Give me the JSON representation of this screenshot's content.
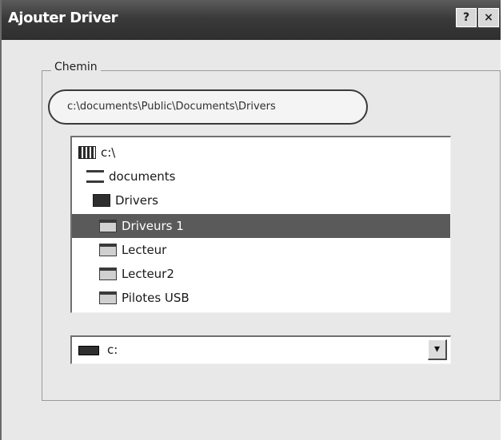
{
  "window": {
    "title": "Ajouter Driver",
    "help_glyph": "?",
    "close_glyph": "×"
  },
  "group": {
    "label": "Chemin"
  },
  "path": {
    "value": "c:\\documents\\Public\\Documents\\Drivers"
  },
  "tree": {
    "items": [
      {
        "label": "c:\\",
        "icon": "drive-icon",
        "selected": false
      },
      {
        "label": "documents",
        "icon": "folder-open-icon",
        "selected": false
      },
      {
        "label": "Drivers",
        "icon": "folder-open-icon",
        "selected": false
      },
      {
        "label": "Driveurs 1",
        "icon": "folder-icon",
        "selected": true
      },
      {
        "label": "Lecteur",
        "icon": "folder-icon",
        "selected": false
      },
      {
        "label": "Lecteur2",
        "icon": "folder-icon",
        "selected": false
      },
      {
        "label": "Pilotes USB",
        "icon": "folder-icon",
        "selected": false
      }
    ]
  },
  "drive_select": {
    "value": "c:",
    "dropdown_glyph": "▾"
  }
}
